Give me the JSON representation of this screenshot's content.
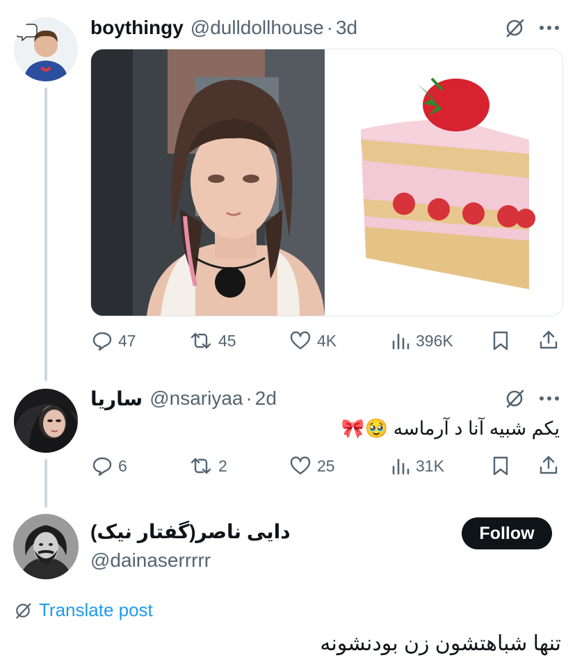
{
  "tweets": [
    {
      "name": "boythingy",
      "handle": "@dulldollhouse",
      "sep": "·",
      "time": "3d",
      "stats": {
        "replies": "47",
        "reposts": "45",
        "likes": "4K",
        "views": "396K"
      }
    },
    {
      "name": "ساریا",
      "handle": "@nsariyaa",
      "sep": "·",
      "time": "2d",
      "text": "یکم شبیه آنا د آرماسه 🥹🎀",
      "stats": {
        "replies": "6",
        "reposts": "2",
        "likes": "25",
        "views": "31K"
      }
    }
  ],
  "focused": {
    "name": "دایی ناصر(گفتار نیک)",
    "handle": "@dainaserrrrr",
    "follow_label": "Follow",
    "translate_label": "Translate post",
    "text": "تنها شباهتشون زن بودنشونه"
  },
  "colors": {
    "accent": "#1d9bf0",
    "text": "#0f1419",
    "muted": "#536471",
    "line": "#cfd9de"
  },
  "icons": [
    "grok-icon",
    "more-icon",
    "reply-icon",
    "repost-icon",
    "like-icon",
    "views-icon",
    "bookmark-icon",
    "share-icon",
    "translate-icon"
  ]
}
